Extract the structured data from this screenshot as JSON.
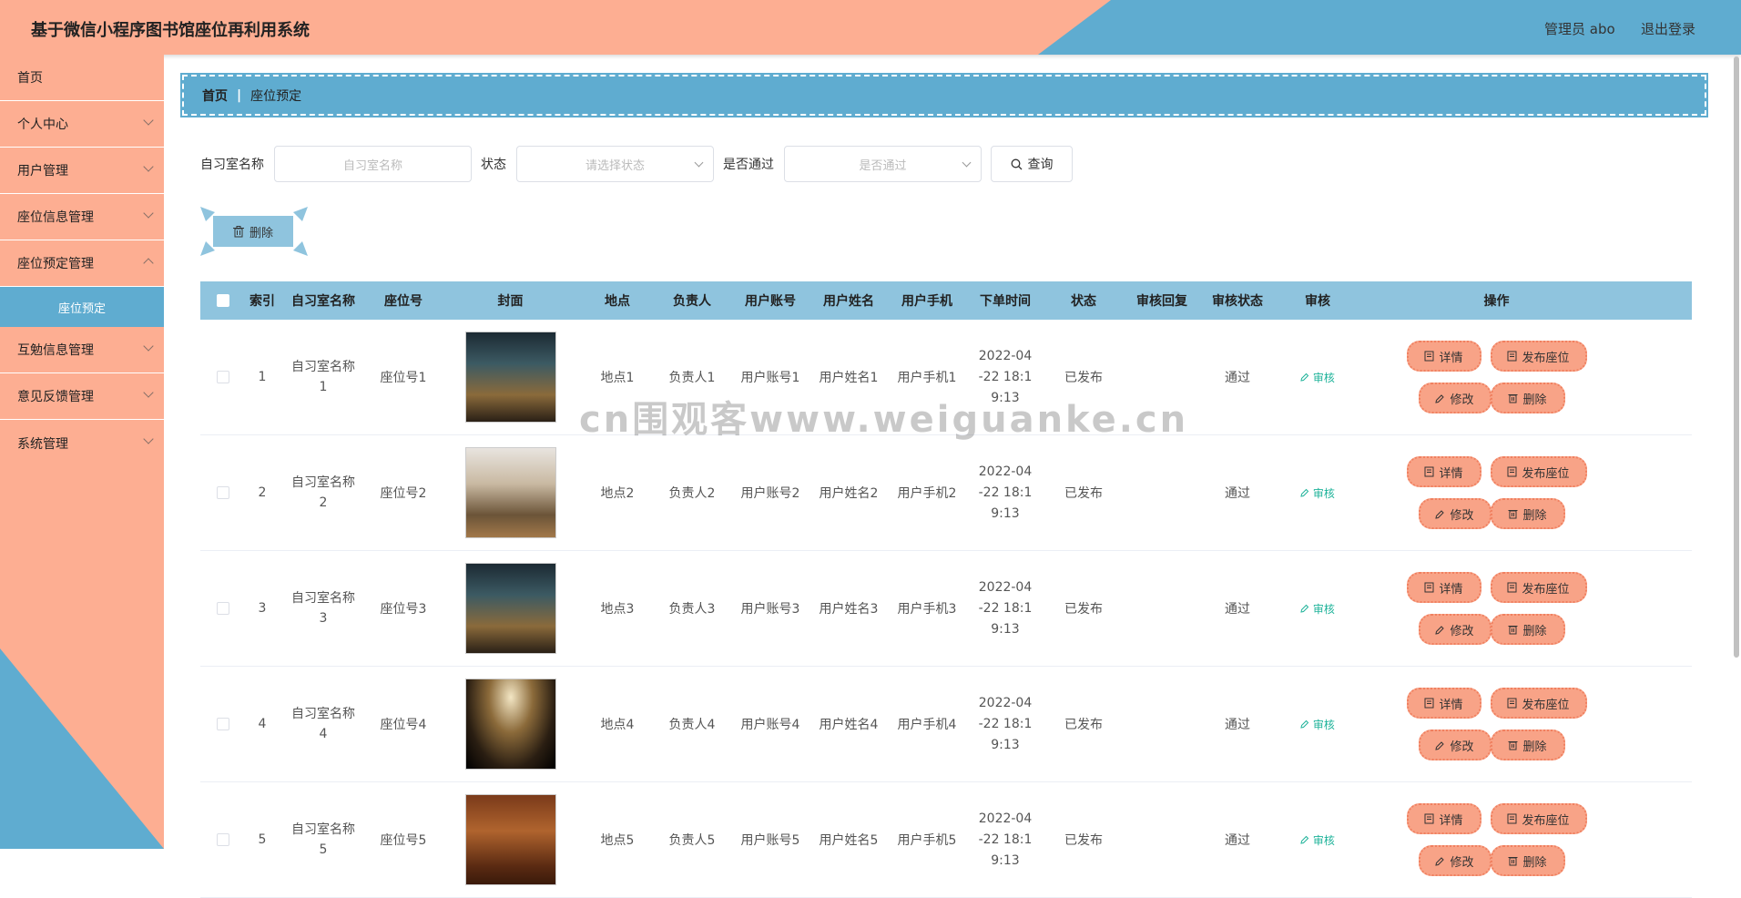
{
  "header": {
    "title": "基于微信小程序图书馆座位再利用系统",
    "user": "管理员 abo",
    "logout": "退出登录"
  },
  "sidebar": {
    "items": [
      {
        "label": "首页"
      },
      {
        "label": "个人中心"
      },
      {
        "label": "用户管理"
      },
      {
        "label": "座位信息管理"
      },
      {
        "label": "座位预定管理"
      },
      {
        "label": "座位预定"
      },
      {
        "label": "互勉信息管理"
      },
      {
        "label": "意见反馈管理"
      },
      {
        "label": "系统管理"
      }
    ]
  },
  "breadcrumb": {
    "home": "首页",
    "current": "座位预定"
  },
  "search": {
    "room_label": "自习室名称",
    "room_placeholder": "自习室名称",
    "status_label": "状态",
    "status_placeholder": "请选择状态",
    "pass_label": "是否通过",
    "pass_placeholder": "是否通过",
    "query_button": "查询"
  },
  "batch_delete": "删除",
  "table": {
    "headers": [
      "索引",
      "自习室名称",
      "座位号",
      "封面",
      "地点",
      "负责人",
      "用户账号",
      "用户姓名",
      "用户手机",
      "下单时间",
      "状态",
      "审核回复",
      "审核状态",
      "审核",
      "操作"
    ],
    "rows": [
      {
        "index": "1",
        "room": "自习室名称1",
        "seat": "座位号1",
        "place": "地点1",
        "owner": "负责人1",
        "account": "用户账号1",
        "name": "用户姓名1",
        "phone": "用户手机1",
        "time": "2022-04-22 18:19:13",
        "status": "已发布",
        "reply": "",
        "audit_status": "通过",
        "audit": "审核"
      },
      {
        "index": "2",
        "room": "自习室名称2",
        "seat": "座位号2",
        "place": "地点2",
        "owner": "负责人2",
        "account": "用户账号2",
        "name": "用户姓名2",
        "phone": "用户手机2",
        "time": "2022-04-22 18:19:13",
        "status": "已发布",
        "reply": "",
        "audit_status": "通过",
        "audit": "审核"
      },
      {
        "index": "3",
        "room": "自习室名称3",
        "seat": "座位号3",
        "place": "地点3",
        "owner": "负责人3",
        "account": "用户账号3",
        "name": "用户姓名3",
        "phone": "用户手机3",
        "time": "2022-04-22 18:19:13",
        "status": "已发布",
        "reply": "",
        "audit_status": "通过",
        "audit": "审核"
      },
      {
        "index": "4",
        "room": "自习室名称4",
        "seat": "座位号4",
        "place": "地点4",
        "owner": "负责人4",
        "account": "用户账号4",
        "name": "用户姓名4",
        "phone": "用户手机4",
        "time": "2022-04-22 18:19:13",
        "status": "已发布",
        "reply": "",
        "audit_status": "通过",
        "audit": "审核"
      },
      {
        "index": "5",
        "room": "自习室名称5",
        "seat": "座位号5",
        "place": "地点5",
        "owner": "负责人5",
        "account": "用户账号5",
        "name": "用户姓名5",
        "phone": "用户手机5",
        "time": "2022-04-22 18:19:13",
        "status": "已发布",
        "reply": "",
        "audit_status": "通过",
        "audit": "审核"
      }
    ],
    "actions": {
      "detail": "详情",
      "publish": "发布座位",
      "edit": "修改",
      "delete": "删除"
    }
  },
  "watermark": "cn围观客www.weiguanke.cn",
  "colors": {
    "salmon": "#fdae92",
    "blue": "#5facd0",
    "light_blue": "#8fc4de",
    "audit_green": "#1fb39a"
  }
}
